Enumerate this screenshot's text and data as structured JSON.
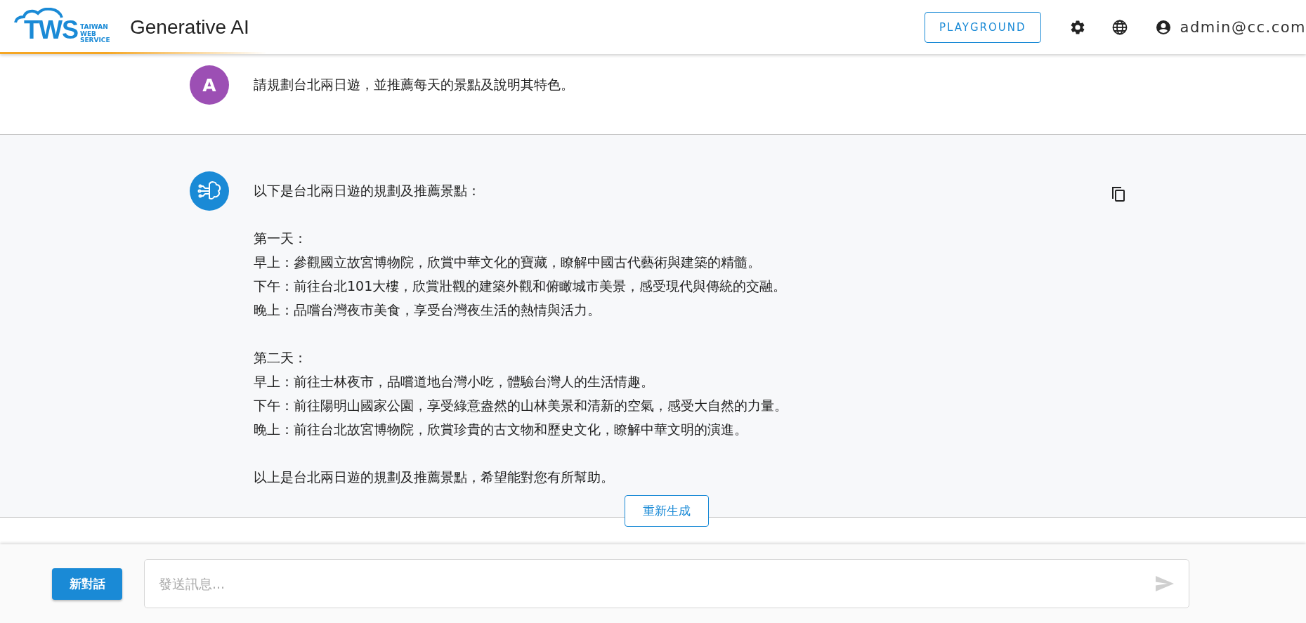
{
  "header": {
    "logo": {
      "mark": "TWS",
      "tagline": [
        "TAIWAN",
        "WEB",
        "SERVICE"
      ]
    },
    "title": "Generative AI",
    "playground_button": "PLAYGROUND",
    "user_email": "admin@cc.com"
  },
  "messages": [
    {
      "kind": "user",
      "avatar_letter": "A",
      "paragraphs": [
        [
          "請規劃台北兩日遊，並推薦每天的景點及說明其特色。"
        ]
      ]
    },
    {
      "kind": "assistant",
      "paragraphs": [
        [
          "以下是台北兩日遊的規劃及推薦景點："
        ],
        [
          "第一天：",
          "早上：參觀國立故宮博物院，欣賞中華文化的寶藏，瞭解中國古代藝術與建築的精髓。",
          "下午：前往台北101大樓，欣賞壯觀的建築外觀和俯瞰城市美景，感受現代與傳統的交融。",
          "晚上：品嚐台灣夜市美食，享受台灣夜生活的熱情與活力。"
        ],
        [
          "第二天：",
          "早上：前往士林夜市，品嚐道地台灣小吃，體驗台灣人的生活情趣。",
          "下午：前往陽明山國家公園，享受綠意盎然的山林美景和清新的空氣，感受大自然的力量。",
          "晚上：前往台北故宮博物院，欣賞珍貴的古文物和歷史文化，瞭解中華文明的演進。"
        ],
        [
          "以上是台北兩日遊的規劃及推薦景點，希望能對您有所幫助。"
        ]
      ],
      "regenerate_button": "重新生成"
    }
  ],
  "composer": {
    "new_chat_button": "新對話",
    "placeholder": "發送訊息..."
  }
}
